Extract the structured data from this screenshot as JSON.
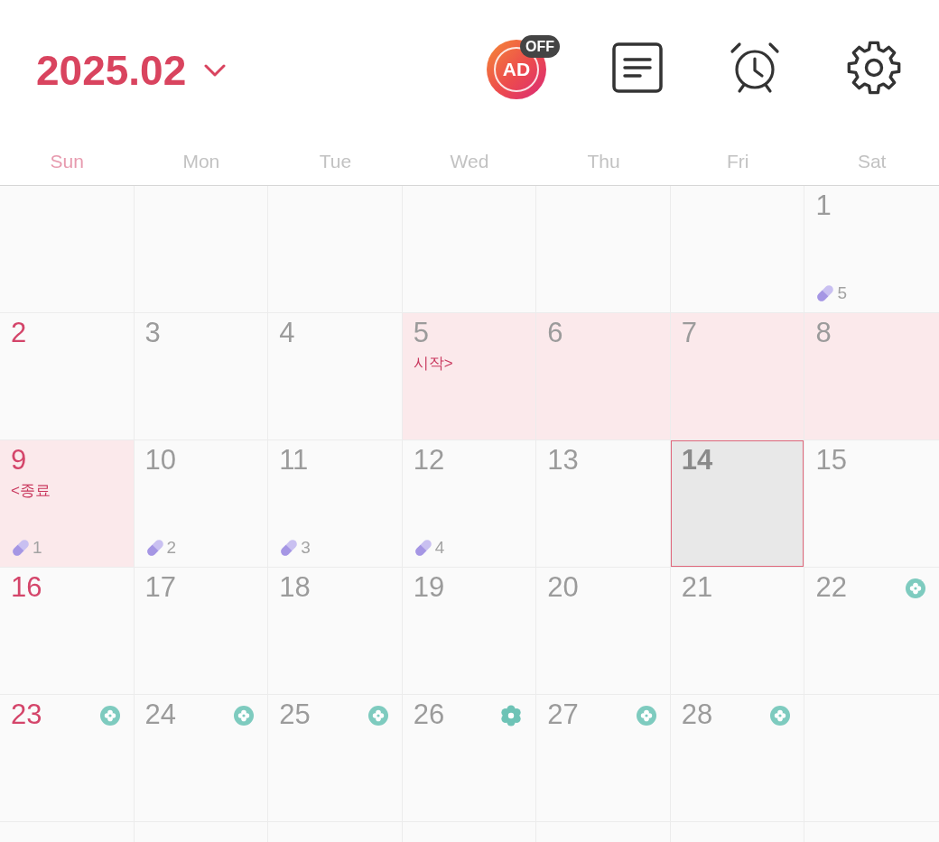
{
  "header": {
    "month": "2025.02",
    "ad_toggle": {
      "label": "AD",
      "badge": "OFF"
    }
  },
  "weekdays": [
    {
      "label": "Sun",
      "sunday": true
    },
    {
      "label": "Mon",
      "sunday": false
    },
    {
      "label": "Tue",
      "sunday": false
    },
    {
      "label": "Wed",
      "sunday": false
    },
    {
      "label": "Thu",
      "sunday": false
    },
    {
      "label": "Fri",
      "sunday": false
    },
    {
      "label": "Sat",
      "sunday": false
    }
  ],
  "weeks": [
    [
      {
        "kind": "blank"
      },
      {
        "kind": "blank"
      },
      {
        "kind": "blank"
      },
      {
        "kind": "blank"
      },
      {
        "kind": "blank"
      },
      {
        "kind": "blank"
      },
      {
        "kind": "day",
        "date": "1",
        "sunday": false,
        "period": false,
        "today": false,
        "pill": "5"
      }
    ],
    [
      {
        "kind": "day",
        "date": "2",
        "sunday": true,
        "period": false,
        "today": false
      },
      {
        "kind": "day",
        "date": "3",
        "sunday": false,
        "period": false,
        "today": false
      },
      {
        "kind": "day",
        "date": "4",
        "sunday": false,
        "period": false,
        "today": false
      },
      {
        "kind": "day",
        "date": "5",
        "sunday": false,
        "period": true,
        "today": false,
        "note": "시작>"
      },
      {
        "kind": "day",
        "date": "6",
        "sunday": false,
        "period": true,
        "today": false
      },
      {
        "kind": "day",
        "date": "7",
        "sunday": false,
        "period": true,
        "today": false
      },
      {
        "kind": "day",
        "date": "8",
        "sunday": false,
        "period": true,
        "today": false
      }
    ],
    [
      {
        "kind": "day",
        "date": "9",
        "sunday": true,
        "period": true,
        "today": false,
        "note": "<종료",
        "pill": "1"
      },
      {
        "kind": "day",
        "date": "10",
        "sunday": false,
        "period": false,
        "today": false,
        "pill": "2"
      },
      {
        "kind": "day",
        "date": "11",
        "sunday": false,
        "period": false,
        "today": false,
        "pill": "3"
      },
      {
        "kind": "day",
        "date": "12",
        "sunday": false,
        "period": false,
        "today": false,
        "pill": "4"
      },
      {
        "kind": "day",
        "date": "13",
        "sunday": false,
        "period": false,
        "today": false
      },
      {
        "kind": "day",
        "date": "14",
        "sunday": false,
        "period": false,
        "today": true
      },
      {
        "kind": "day",
        "date": "15",
        "sunday": false,
        "period": false,
        "today": false
      }
    ],
    [
      {
        "kind": "day",
        "date": "16",
        "sunday": true,
        "period": false,
        "today": false
      },
      {
        "kind": "day",
        "date": "17",
        "sunday": false,
        "period": false,
        "today": false
      },
      {
        "kind": "day",
        "date": "18",
        "sunday": false,
        "period": false,
        "today": false
      },
      {
        "kind": "day",
        "date": "19",
        "sunday": false,
        "period": false,
        "today": false
      },
      {
        "kind": "day",
        "date": "20",
        "sunday": false,
        "period": false,
        "today": false
      },
      {
        "kind": "day",
        "date": "21",
        "sunday": false,
        "period": false,
        "today": false
      },
      {
        "kind": "day",
        "date": "22",
        "sunday": false,
        "period": false,
        "today": false,
        "flower": {
          "filled": false
        }
      }
    ],
    [
      {
        "kind": "day",
        "date": "23",
        "sunday": true,
        "period": false,
        "today": false,
        "flower": {
          "filled": false
        }
      },
      {
        "kind": "day",
        "date": "24",
        "sunday": false,
        "period": false,
        "today": false,
        "flower": {
          "filled": false
        }
      },
      {
        "kind": "day",
        "date": "25",
        "sunday": false,
        "period": false,
        "today": false,
        "flower": {
          "filled": false
        }
      },
      {
        "kind": "day",
        "date": "26",
        "sunday": false,
        "period": false,
        "today": false,
        "flower": {
          "filled": true
        }
      },
      {
        "kind": "day",
        "date": "27",
        "sunday": false,
        "period": false,
        "today": false,
        "flower": {
          "filled": false
        }
      },
      {
        "kind": "day",
        "date": "28",
        "sunday": false,
        "period": false,
        "today": false,
        "flower": {
          "filled": false
        }
      },
      {
        "kind": "blank"
      }
    ]
  ]
}
